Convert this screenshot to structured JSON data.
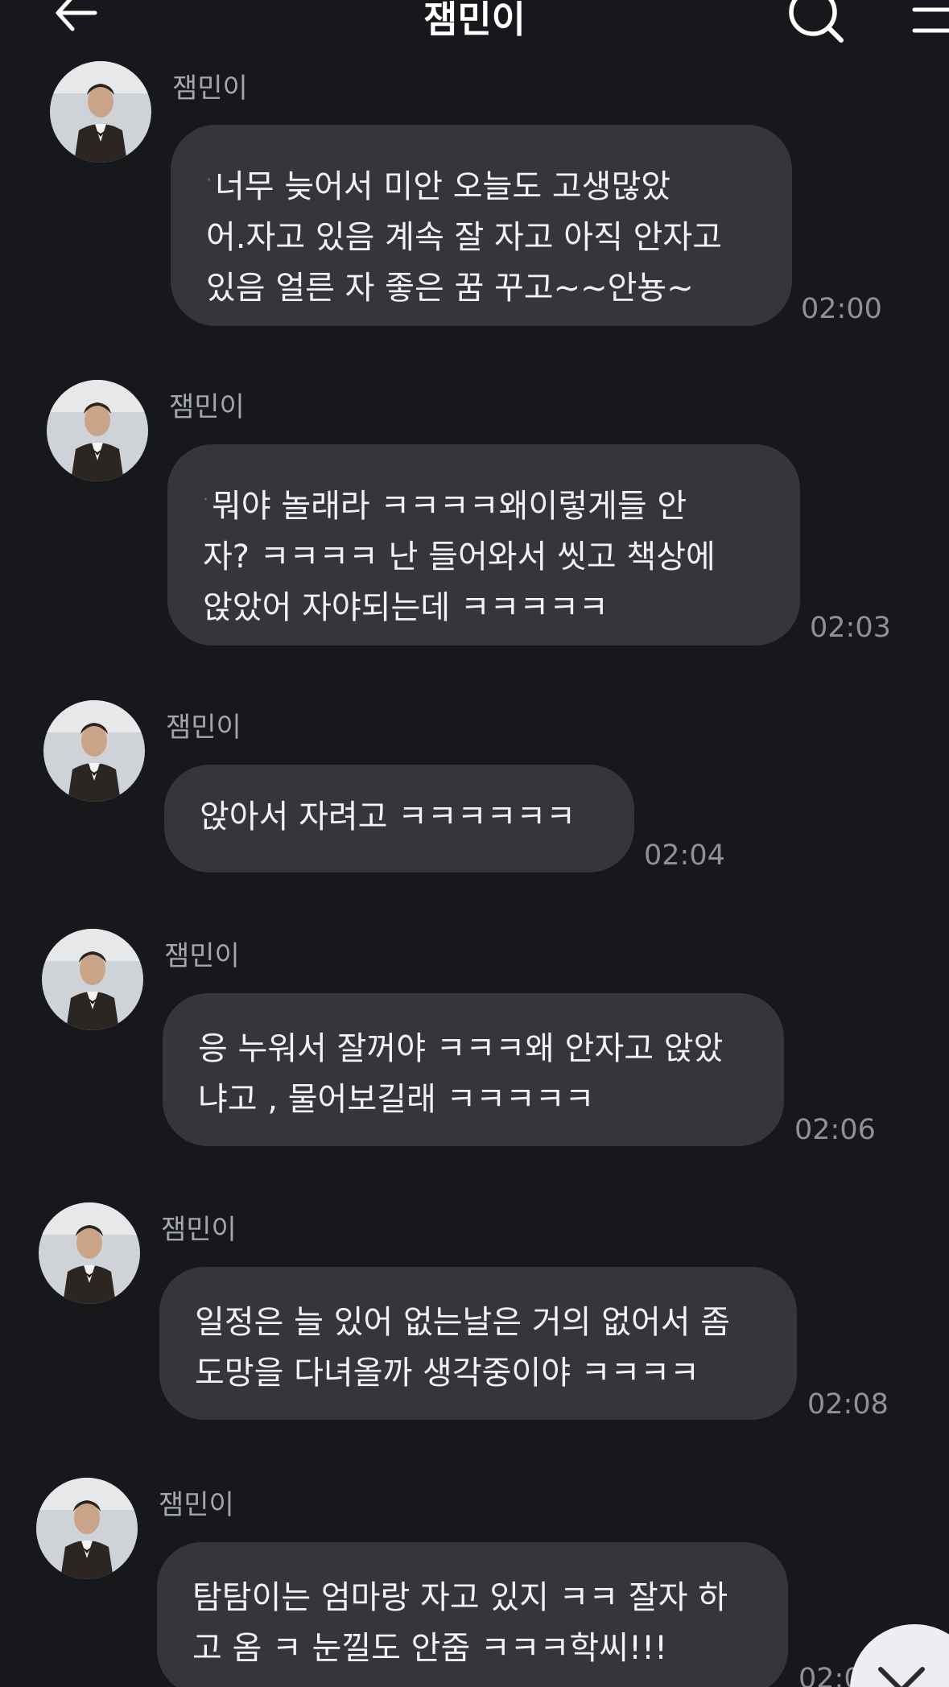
{
  "header": {
    "title": "잼민이",
    "back_icon": "arrow-left-icon",
    "search_icon": "search-icon",
    "menu_icon": "hamburger-menu-icon"
  },
  "messages": [
    {
      "sender": "잼민이",
      "lines": [
        "너무 늦어서 미안 오늘도 고생많았",
        "어.자고 있음 계속 잘 자고 아직 안자고",
        "있음 얼른 자 좋은 꿈 꾸고~~안뇽~"
      ],
      "time": "02:00"
    },
    {
      "sender": "잼민이",
      "lines": [
        "뭐야 놀래라 ㅋㅋㅋㅋ왜이렇게들 안",
        "자? ㅋㅋㅋㅋ 난 들어와서 씻고 책상에",
        "앉았어 자야되는데 ㅋㅋㅋㅋㅋ"
      ],
      "time": "02:03"
    },
    {
      "sender": "잼민이",
      "lines": [
        "앉아서 자려고 ㅋㅋㅋㅋㅋㅋ"
      ],
      "time": "02:04"
    },
    {
      "sender": "잼민이",
      "lines": [
        "응 누워서 잘꺼야 ㅋㅋㅋ왜 안자고 앉았",
        "냐고 , 물어보길래 ㅋㅋㅋㅋㅋ"
      ],
      "time": "02:06"
    },
    {
      "sender": "잼민이",
      "lines": [
        "일정은 늘 있어 없는날은 거의 없어서 좀",
        "도망을 다녀올까 생각중이야 ㅋㅋㅋㅋ"
      ],
      "time": "02:08"
    },
    {
      "sender": "잼민이",
      "lines": [
        "탐탐이는 엄마랑 자고 있지 ㅋㅋ 잘자 하",
        "고 옴 ㅋ 눈낄도 안줌 ㅋㅋㅋ학씨!!!"
      ],
      "time": "02:0"
    }
  ],
  "colors": {
    "background": "#17181c",
    "bubble": "#34363c",
    "sender_name": "#a4a6ad",
    "timestamp": "#8f9197"
  },
  "scroll_down_icon": "chevron-down-icon"
}
